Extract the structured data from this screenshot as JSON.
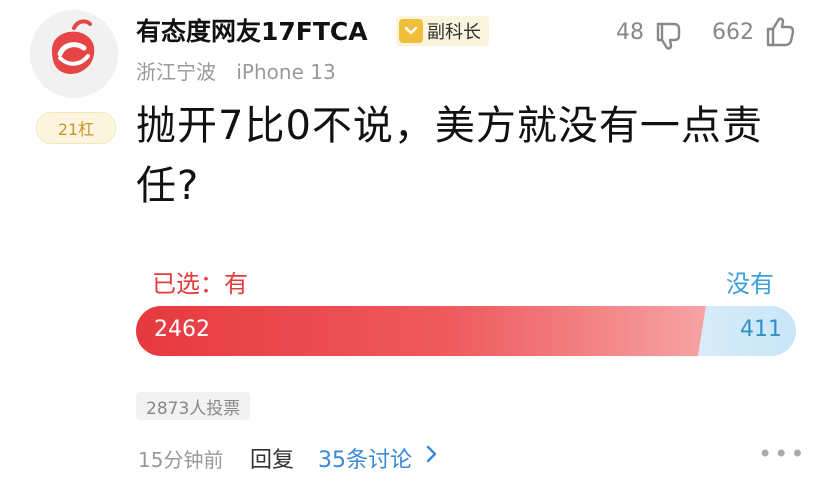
{
  "user": {
    "name": "有态度网友17FTCA",
    "level": "副科长",
    "location": "浙江宁波",
    "device": "iPhone 13",
    "rank": "21杠"
  },
  "reactions": {
    "dislikes": "48",
    "likes": "662"
  },
  "post": {
    "question": "抛开7比0不说，美方就没有一点责任?"
  },
  "poll": {
    "chosen_label": "已选：有",
    "other_label": "没有",
    "yes_votes": 2462,
    "no_votes": 411,
    "yes_count_text": "2462",
    "no_count_text": "411",
    "voters": "2873人投票"
  },
  "footer": {
    "time": "15分钟前",
    "reply": "回复",
    "discuss": "35条讨论",
    "more": "•••"
  },
  "colors": {
    "accent_red": "#e6393f",
    "accent_blue": "#3aa0d8"
  }
}
